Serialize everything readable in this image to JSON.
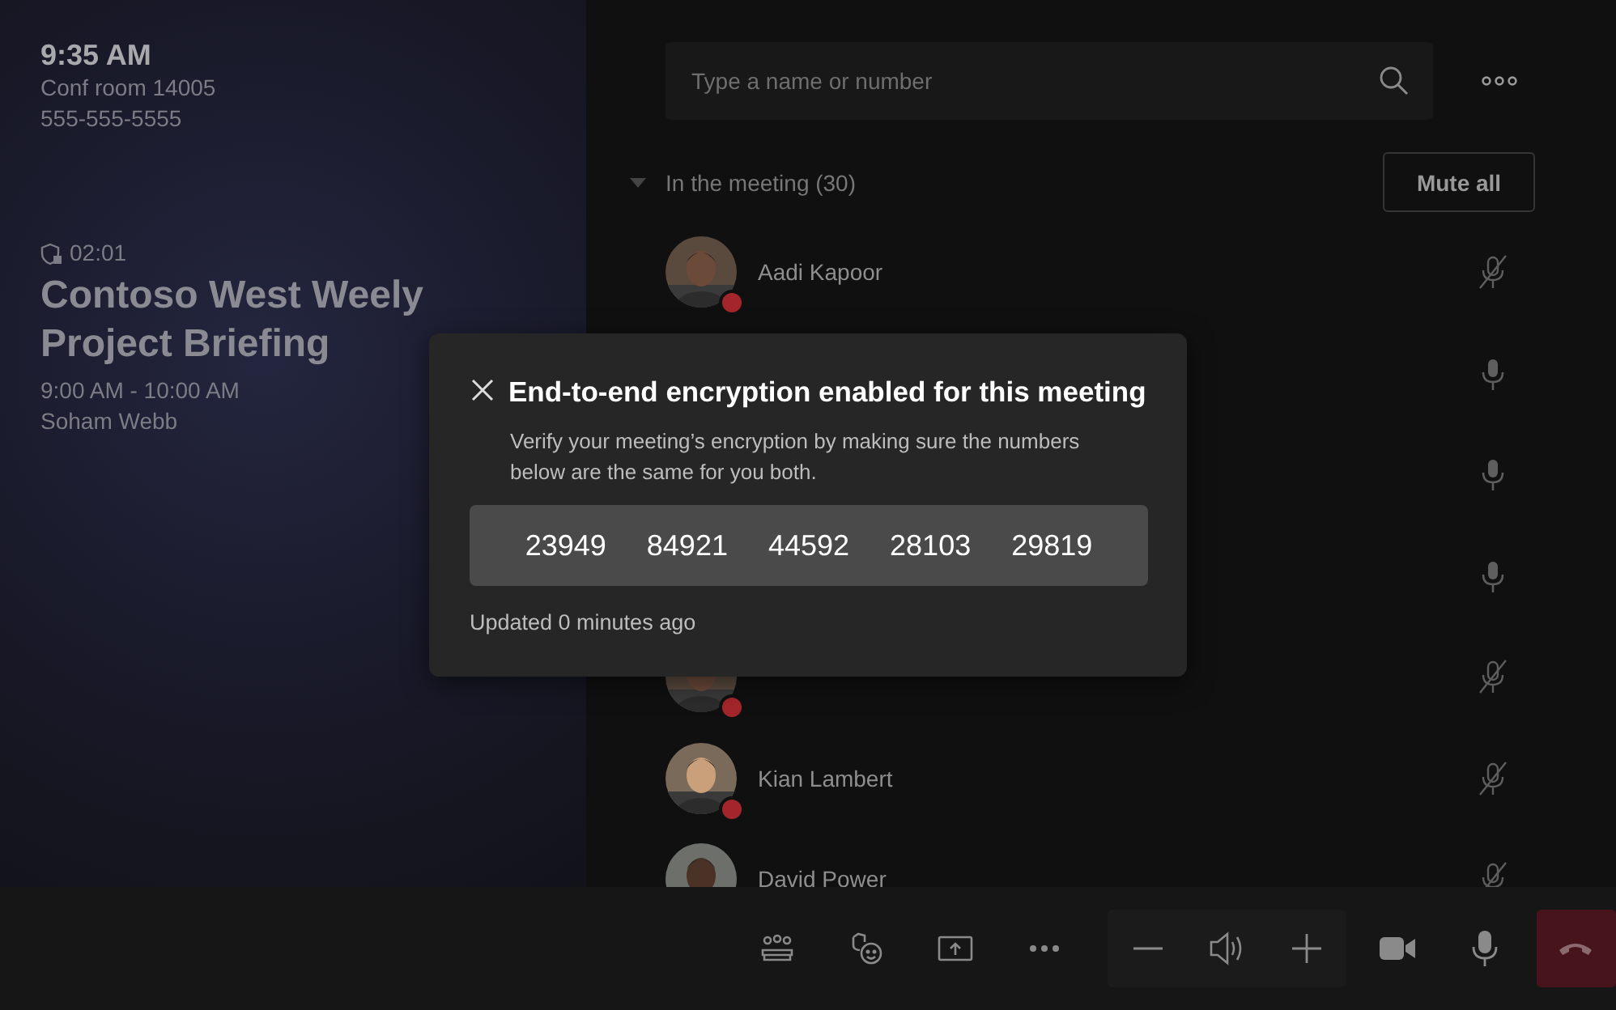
{
  "header": {
    "time": "9:35 AM",
    "room": "Conf room 14005",
    "phone": "555-555-5555"
  },
  "meeting": {
    "duration": "02:01",
    "title": "Contoso West Weely Project Briefing",
    "time_range": "9:00 AM - 10:00 AM",
    "organizer": "Soham Webb"
  },
  "search": {
    "placeholder": "Type a name or number"
  },
  "roster": {
    "heading": "In the meeting (30)",
    "expanded": true,
    "mute_all": "Mute all",
    "participants": [
      {
        "kind": "full",
        "name": "Aadi Kapoor",
        "muted": true,
        "busy": true
      },
      {
        "kind": "covered",
        "muted": false
      },
      {
        "kind": "covered",
        "muted": false
      },
      {
        "kind": "covered",
        "muted": false
      },
      {
        "kind": "partial",
        "muted": true,
        "busy": true
      },
      {
        "kind": "full",
        "name": "Kian Lambert",
        "muted": true,
        "busy": true
      },
      {
        "kind": "full",
        "name": "David Power",
        "muted": true
      }
    ]
  },
  "dialog": {
    "title": "End-to-end encryption enabled for this meeting",
    "message": "Verify your meeting’s encryption by making sure the numbers below are the same for you both.",
    "codes": [
      "23949",
      "84921",
      "44592",
      "28103",
      "29819"
    ],
    "updated": "Updated 0 minutes ago"
  }
}
